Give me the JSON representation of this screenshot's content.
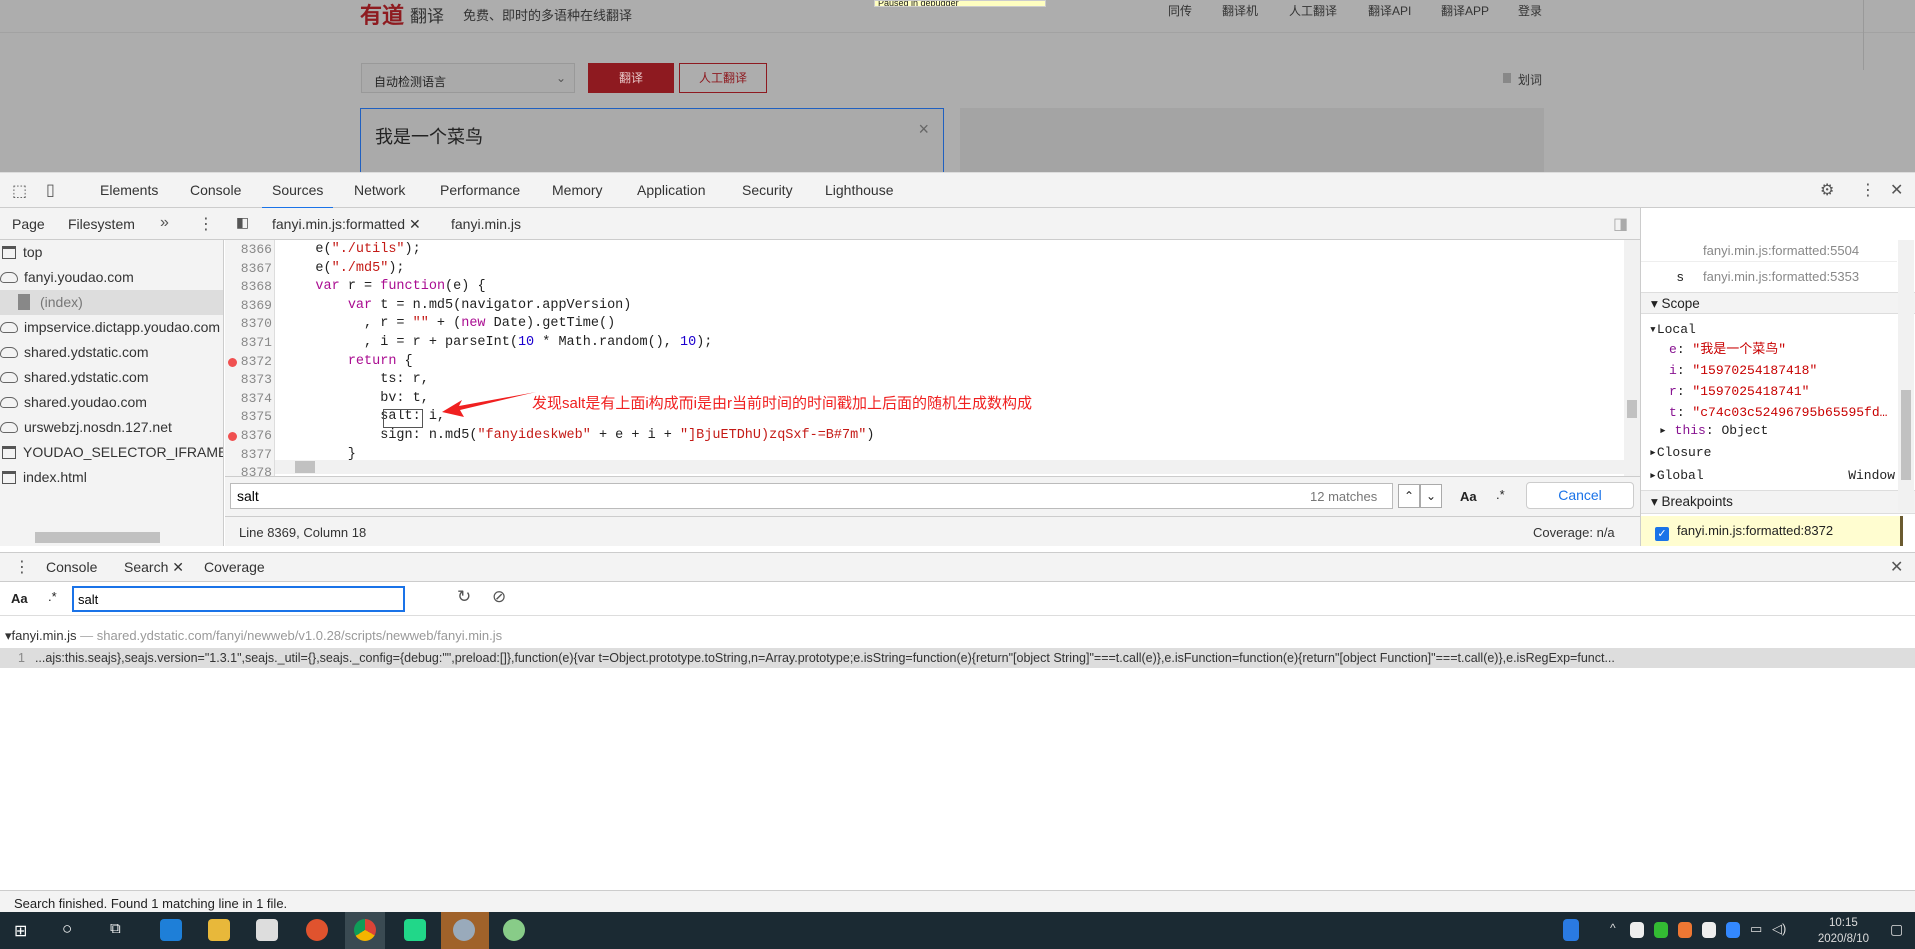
{
  "site": {
    "logo": "有道",
    "logo_suffix": "翻译",
    "slogan": "免费、即时的多语种在线翻译",
    "paused_banner": "Paused in debugger",
    "nav": [
      "同传",
      "翻译机",
      "人工翻译",
      "翻译API",
      "翻译APP",
      "登录"
    ],
    "lang_select": "自动检测语言",
    "translate_btn": "翻译",
    "human_btn": "人工翻译",
    "huaci": "划词",
    "input_text": "我是一个菜鸟",
    "clear": "×"
  },
  "devtools": {
    "tabs": [
      "Elements",
      "Console",
      "Sources",
      "Network",
      "Performance",
      "Memory",
      "Application",
      "Security",
      "Lighthouse"
    ],
    "active_tab": "Sources",
    "nav_tabs": [
      "Page",
      "Filesystem"
    ],
    "file_tabs": [
      "fanyi.min.js:formatted",
      "fanyi.min.js"
    ],
    "tree": [
      {
        "label": "top",
        "icon": "frame-icon"
      },
      {
        "label": "fanyi.youdao.com",
        "icon": "cloud-icon"
      },
      {
        "label": "(index)",
        "icon": "file-icon"
      },
      {
        "label": "impservice.dictapp.youdao.com",
        "icon": "cloud-icon"
      },
      {
        "label": "shared.ydstatic.com",
        "icon": "cloud-icon"
      },
      {
        "label": "shared.ydstatic.com",
        "icon": "cloud-icon"
      },
      {
        "label": "shared.youdao.com",
        "icon": "cloud-icon"
      },
      {
        "label": "urswebzj.nosdn.127.net",
        "icon": "cloud-icon"
      },
      {
        "label": "YOUDAO_SELECTOR_IFRAME (",
        "icon": "frame-icon"
      },
      {
        "label": "index.html",
        "icon": "frame-icon"
      }
    ],
    "code": [
      {
        "ln": "8366",
        "bp": false,
        "seg": [
          [
            "    e(",
            ""
          ],
          [
            "\"./utils\"",
            "s"
          ],
          [
            ");",
            ""
          ]
        ]
      },
      {
        "ln": "8367",
        "bp": false,
        "seg": [
          [
            "    e(",
            ""
          ],
          [
            "\"./md5\"",
            "s"
          ],
          [
            ");",
            ""
          ]
        ]
      },
      {
        "ln": "8368",
        "bp": false,
        "seg": [
          [
            "    ",
            ""
          ],
          [
            "var",
            "k"
          ],
          [
            " r = ",
            ""
          ],
          [
            "function",
            "k"
          ],
          [
            "(e) {",
            ""
          ]
        ]
      },
      {
        "ln": "8369",
        "bp": false,
        "seg": [
          [
            "        ",
            ""
          ],
          [
            "var",
            "k"
          ],
          [
            " t = n.md5(navigator.appVersion)",
            ""
          ]
        ]
      },
      {
        "ln": "8370",
        "bp": false,
        "seg": [
          [
            "          , r = ",
            ""
          ],
          [
            "\"\"",
            "s"
          ],
          [
            " + (",
            ""
          ],
          [
            "new",
            "k"
          ],
          [
            " Date).getTime()",
            ""
          ]
        ]
      },
      {
        "ln": "8371",
        "bp": false,
        "seg": [
          [
            "          , i = r + parseInt(",
            ""
          ],
          [
            "10",
            "n"
          ],
          [
            " * Math.random(), ",
            ""
          ],
          [
            "10",
            "n"
          ],
          [
            ");",
            ""
          ]
        ]
      },
      {
        "ln": "8372",
        "bp": true,
        "seg": [
          [
            "        ",
            ""
          ],
          [
            "return",
            "k"
          ],
          [
            " {",
            ""
          ]
        ]
      },
      {
        "ln": "8373",
        "bp": false,
        "seg": [
          [
            "            ts: r,",
            ""
          ]
        ]
      },
      {
        "ln": "8374",
        "bp": false,
        "seg": [
          [
            "            bv: t,",
            ""
          ]
        ]
      },
      {
        "ln": "8375",
        "bp": false,
        "seg": [
          [
            "            salt: i,",
            ""
          ]
        ]
      },
      {
        "ln": "8376",
        "bp": true,
        "seg": [
          [
            "            sign: n.md5(",
            ""
          ],
          [
            "\"fanyideskweb\"",
            "s"
          ],
          [
            " + e + i + ",
            ""
          ],
          [
            "\"]BjuETDhU)zqSxf-=B#7m\"",
            "s"
          ],
          [
            ")",
            ""
          ]
        ]
      },
      {
        "ln": "8377",
        "bp": false,
        "seg": [
          [
            "        }",
            ""
          ]
        ]
      },
      {
        "ln": "8378",
        "bp": false,
        "seg": [
          [
            "",
            ""
          ]
        ]
      }
    ],
    "annotation": "发现salt是有上面i构成而i是由r当前时间的时间戳加上后面的随机生成数构成",
    "find": {
      "value": "salt",
      "matches": "12 matches",
      "case": "Aa",
      "regex": ".*",
      "cancel": "Cancel"
    },
    "status": {
      "position": "Line 8369, Column 18",
      "coverage": "Coverage: n/a"
    },
    "callstack": [
      {
        "name": "",
        "loc": "fanyi.min.js:formatted:5504"
      },
      {
        "name": "s",
        "loc": "fanyi.min.js:formatted:5353"
      }
    ],
    "scope": {
      "title": "Scope",
      "local": "Local",
      "vars": [
        {
          "k": "e",
          "v": "\"我是一个菜鸟\""
        },
        {
          "k": "i",
          "v": "\"15970254187418\""
        },
        {
          "k": "r",
          "v": "\"1597025418741\""
        },
        {
          "k": "t",
          "v": "\"c74c03c52496795b65595fd…"
        }
      ],
      "this_k": "this",
      "this_v": "Object",
      "closure": "Closure",
      "global": "Global",
      "global_v": "Window"
    },
    "breakpoints": {
      "title": "Breakpoints",
      "item": "fanyi.min.js:formatted:8372",
      "checked": true
    },
    "drawer": {
      "tabs": [
        "Console",
        "Search",
        "Coverage"
      ],
      "active": "Search",
      "case": "Aa",
      "regex": ".*",
      "query": "salt",
      "result_file": "fanyi.min.js",
      "result_sep": " — ",
      "result_path": "shared.ydstatic.com/fanyi/newweb/v1.0.28/scripts/newweb/fanyi.min.js",
      "result_line_no": "1",
      "result_line": "...ajs:this.seajs},seajs.version=\"1.3.1\",seajs._util={},seajs._config={debug:\"\",preload:[]},function(e){var t=Object.prototype.toString,n=Array.prototype;e.isString=function(e){return\"[object String]\"===t.call(e)},e.isFunction=function(e){return\"[object Function]\"===t.call(e)},e.isRegExp=funct...",
      "finished": "Search finished.  Found 1 matching line in 1 file."
    }
  },
  "taskbar": {
    "time": "10:15",
    "date": "2020/8/10"
  }
}
